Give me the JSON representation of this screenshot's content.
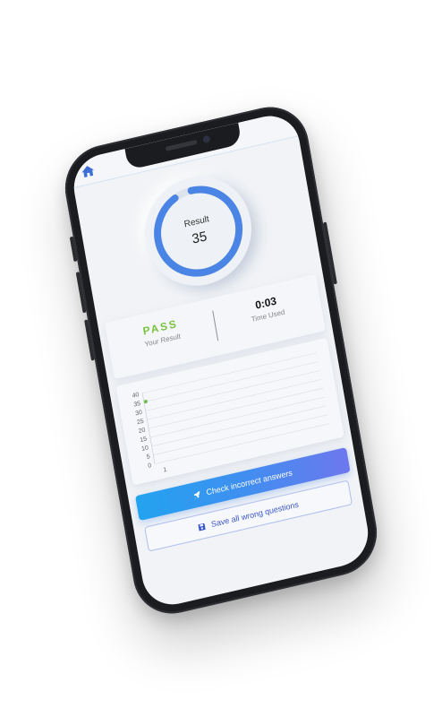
{
  "header": {
    "home_icon": "home-icon"
  },
  "result": {
    "label": "Result",
    "value": "35",
    "ring_fill_fraction": 0.93,
    "ring_color": "#4a84e4"
  },
  "summary": {
    "status_value": "PASS",
    "status_caption": "Your Result",
    "status_color": "#7cc242",
    "time_value": "0:03",
    "time_caption": "Time Used"
  },
  "chart_data": {
    "type": "line",
    "x": [
      1
    ],
    "series": [
      {
        "values": [
          35
        ]
      }
    ],
    "y_ticks": [
      "0",
      "5",
      "10",
      "15",
      "20",
      "25",
      "30",
      "35",
      "40"
    ],
    "x_ticks": [
      "1"
    ],
    "ylim": [
      0,
      40
    ],
    "grid": true,
    "point_color": "#6cc04a"
  },
  "actions": {
    "check_label": "Check incorrect answers",
    "check_icon": "rocket-icon",
    "save_label": "Save all wrong questions",
    "save_icon": "floppy-disk-icon"
  }
}
